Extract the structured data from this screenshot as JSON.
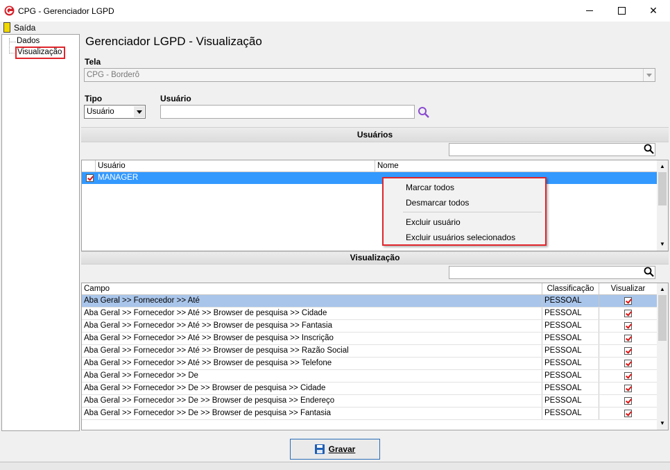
{
  "window": {
    "title": "CPG - Gerenciador LGPD",
    "minimize_glyph": "—",
    "maximize_glyph": "☐",
    "close_glyph": "✕",
    "icon": "app-logo-icon",
    "brand_color": "#d4212a"
  },
  "menu": {
    "saida_label": "Saída",
    "saida_icon": "door-exit-icon"
  },
  "tree": {
    "items": [
      {
        "label": "Dados"
      },
      {
        "label": "Visualização"
      }
    ]
  },
  "page": {
    "title": "Gerenciador LGPD - Visualização"
  },
  "tela": {
    "label": "Tela",
    "value": "CPG - Borderô"
  },
  "tipo": {
    "label": "Tipo",
    "value": "Usuário"
  },
  "usuario": {
    "label": "Usuário",
    "value": ""
  },
  "usuarios_section": {
    "title": "Usuários",
    "search_value": "",
    "columns": [
      "Usuário",
      "Nome"
    ],
    "rows": [
      {
        "usuario": "MANAGER",
        "nome": "",
        "checked": true,
        "selected": true
      }
    ]
  },
  "context_menu": {
    "items": [
      "Marcar todos",
      "Desmarcar todos",
      "Excluir usuário",
      "Excluir usuários selecionados"
    ]
  },
  "visualizacao_section": {
    "title": "Visualização",
    "search_value": "",
    "columns": [
      "Campo",
      "Classificação",
      "Visualizar"
    ],
    "rows": [
      {
        "campo": "Aba Geral >> Fornecedor >> Até",
        "classificacao": "PESSOAL",
        "visualizar": true
      },
      {
        "campo": "Aba Geral >> Fornecedor >> Até >> Browser de pesquisa >> Cidade",
        "classificacao": "PESSOAL",
        "visualizar": true
      },
      {
        "campo": "Aba Geral >> Fornecedor >> Até >> Browser de pesquisa >> Fantasia",
        "classificacao": "PESSOAL",
        "visualizar": true
      },
      {
        "campo": "Aba Geral >> Fornecedor >> Até >> Browser de pesquisa >> Inscrição",
        "classificacao": "PESSOAL",
        "visualizar": true
      },
      {
        "campo": "Aba Geral >> Fornecedor >> Até >> Browser de pesquisa >> Razão Social",
        "classificacao": "PESSOAL",
        "visualizar": true
      },
      {
        "campo": "Aba Geral >> Fornecedor >> Até >> Browser de pesquisa >> Telefone",
        "classificacao": "PESSOAL",
        "visualizar": true
      },
      {
        "campo": "Aba Geral >> Fornecedor >> De",
        "classificacao": "PESSOAL",
        "visualizar": true
      },
      {
        "campo": "Aba Geral >> Fornecedor >> De >> Browser de pesquisa >> Cidade",
        "classificacao": "PESSOAL",
        "visualizar": true
      },
      {
        "campo": "Aba Geral >> Fornecedor >> De >> Browser de pesquisa >> Endereço",
        "classificacao": "PESSOAL",
        "visualizar": true
      },
      {
        "campo": "Aba Geral >> Fornecedor >> De >> Browser de pesquisa >> Fantasia",
        "classificacao": "PESSOAL",
        "visualizar": true
      }
    ]
  },
  "footer": {
    "save_label": "Gravar",
    "save_icon": "floppy-disk-icon"
  },
  "colors": {
    "selection": "#3399ff",
    "highlight_row": "#a9c5ea",
    "accent_border": "#e0252b",
    "search_icon": "#8a4bd0"
  }
}
